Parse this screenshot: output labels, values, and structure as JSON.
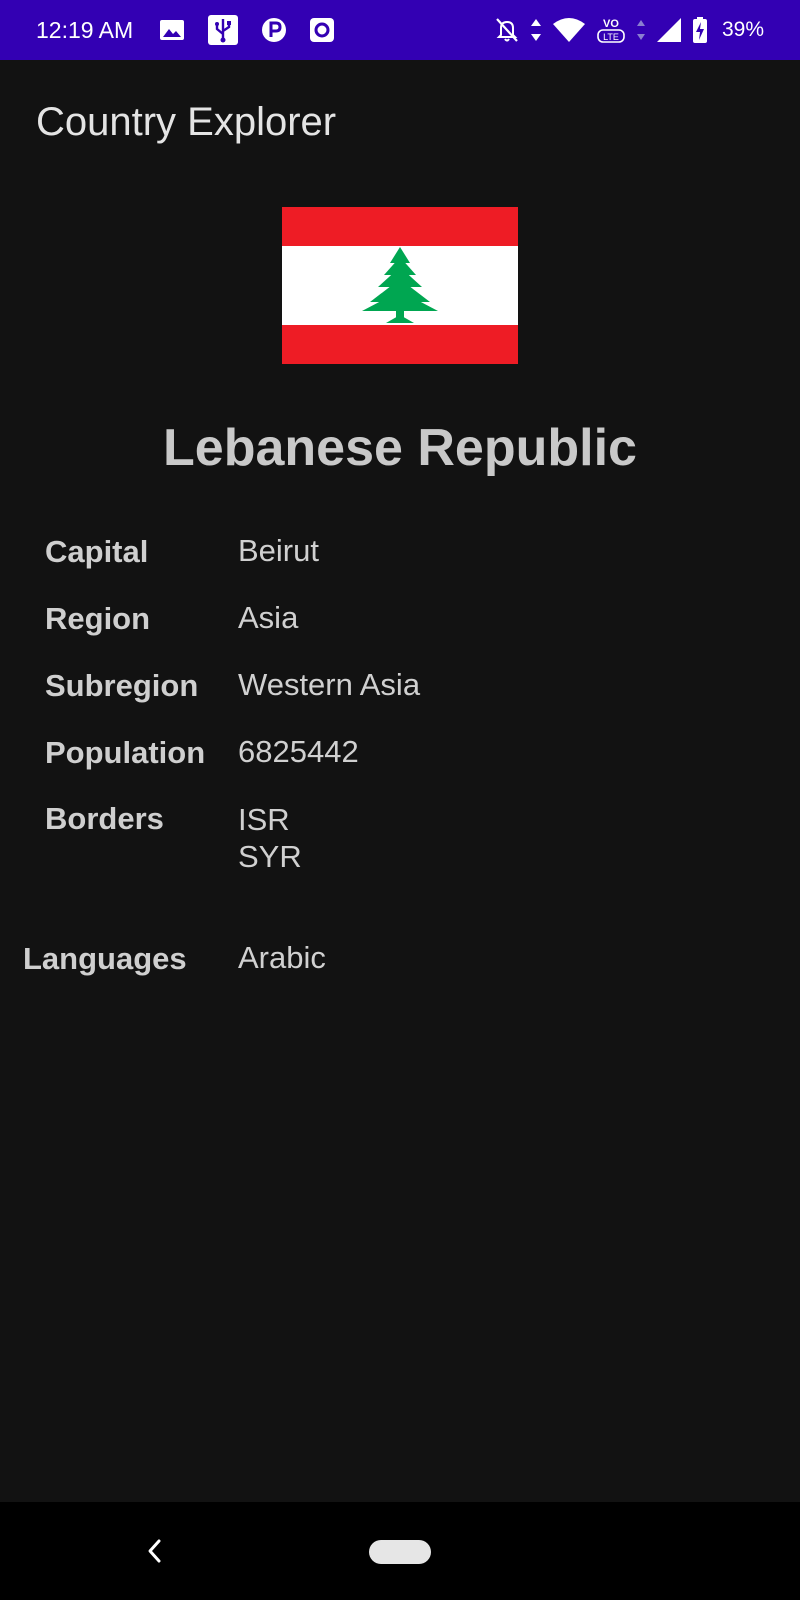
{
  "status_bar": {
    "time": "12:19 AM",
    "left_icons": [
      "gallery-icon",
      "usb-icon",
      "parking-app-icon",
      "camera-app-icon"
    ],
    "right_icons": [
      "notifications-off-icon",
      "data-arrows-icon",
      "wifi-icon",
      "volte-icon",
      "signal-icon",
      "battery-icon"
    ],
    "volte_label": "VoLTE",
    "battery_percent": "39%"
  },
  "app": {
    "title": "Country Explorer"
  },
  "country": {
    "flag": {
      "name": "lebanon-flag",
      "colors": {
        "red": "#ee1c25",
        "white": "#ffffff",
        "green": "#00a651"
      }
    },
    "name": "Lebanese Republic",
    "fields": {
      "capital": {
        "label": "Capital",
        "value": "Beirut"
      },
      "region": {
        "label": "Region",
        "value": "Asia"
      },
      "subregion": {
        "label": "Subregion",
        "value": "Western Asia"
      },
      "population": {
        "label": "Population",
        "value": "6825442"
      },
      "borders": {
        "label": "Borders",
        "values": [
          "ISR",
          "SYR"
        ]
      },
      "languages": {
        "label": "Languages",
        "value": "Arabic"
      }
    }
  },
  "nav_bar": {
    "back_icon": "back-chevron-icon",
    "home_icon": "home-pill-icon"
  },
  "colors": {
    "status_bar": "#3300b3",
    "background": "#121212",
    "nav_bar": "#000000"
  }
}
